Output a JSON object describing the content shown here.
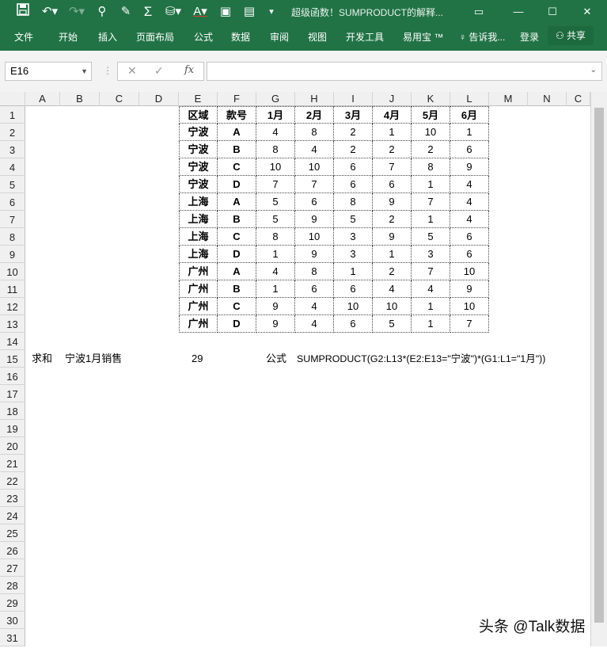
{
  "window": {
    "title": "超级函数！SUMPRODUCT的解释...",
    "qat_icons": [
      "save-icon",
      "undo-icon",
      "redo-icon",
      "add-user-icon",
      "format-painter-icon",
      "autosum-icon",
      "fill-color-icon",
      "font-color-icon",
      "picture-icon",
      "chart-icon",
      "customize-qat-icon"
    ],
    "controls": [
      "ribbon-display-icon",
      "minimize-icon",
      "maximize-icon",
      "close-icon"
    ]
  },
  "ribbon": {
    "tabs": [
      "文件",
      "开始",
      "插入",
      "页面布局",
      "公式",
      "数据",
      "审阅",
      "视图",
      "开发工具",
      "易用宝 ™"
    ],
    "tell_me": "告诉我...",
    "login": "登录",
    "share": "共享"
  },
  "formula_bar": {
    "name_box": "E16",
    "formula": ""
  },
  "sheet": {
    "columns": [
      "A",
      "B",
      "C",
      "D",
      "E",
      "F",
      "G",
      "H",
      "I",
      "J",
      "K",
      "L",
      "M",
      "N",
      "C"
    ],
    "rows": [
      "1",
      "2",
      "3",
      "4",
      "5",
      "6",
      "7",
      "8",
      "9",
      "10",
      "11",
      "12",
      "13",
      "14",
      "15",
      "16",
      "17",
      "18",
      "19",
      "20",
      "21",
      "22",
      "23",
      "24",
      "25",
      "26",
      "27",
      "28",
      "29",
      "30",
      "31"
    ],
    "table_header": [
      "区域",
      "款号",
      "1月",
      "2月",
      "3月",
      "4月",
      "5月",
      "6月"
    ],
    "table_rows": [
      [
        "宁波",
        "A",
        "4",
        "8",
        "2",
        "1",
        "10",
        "1"
      ],
      [
        "宁波",
        "B",
        "8",
        "4",
        "2",
        "2",
        "2",
        "6"
      ],
      [
        "宁波",
        "C",
        "10",
        "10",
        "6",
        "7",
        "8",
        "9"
      ],
      [
        "宁波",
        "D",
        "7",
        "7",
        "6",
        "6",
        "1",
        "4"
      ],
      [
        "上海",
        "A",
        "5",
        "6",
        "8",
        "9",
        "7",
        "4"
      ],
      [
        "上海",
        "B",
        "5",
        "9",
        "5",
        "2",
        "1",
        "4"
      ],
      [
        "上海",
        "C",
        "8",
        "10",
        "3",
        "9",
        "5",
        "6"
      ],
      [
        "上海",
        "D",
        "1",
        "9",
        "3",
        "1",
        "3",
        "6"
      ],
      [
        "广州",
        "A",
        "4",
        "8",
        "1",
        "2",
        "7",
        "10"
      ],
      [
        "广州",
        "B",
        "1",
        "6",
        "6",
        "4",
        "4",
        "9"
      ],
      [
        "广州",
        "C",
        "9",
        "4",
        "10",
        "10",
        "1",
        "10"
      ],
      [
        "广州",
        "D",
        "9",
        "4",
        "6",
        "5",
        "1",
        "7"
      ]
    ],
    "row15": {
      "a": "求和",
      "b": "宁波1月销售",
      "result": "29",
      "formula_label": "公式",
      "formula_text": "SUMPRODUCT(G2:L13*(E2:E13=\"宁波\")*(G1:L1=\"1月\"))"
    }
  },
  "watermark": "头条 @Talk数据"
}
